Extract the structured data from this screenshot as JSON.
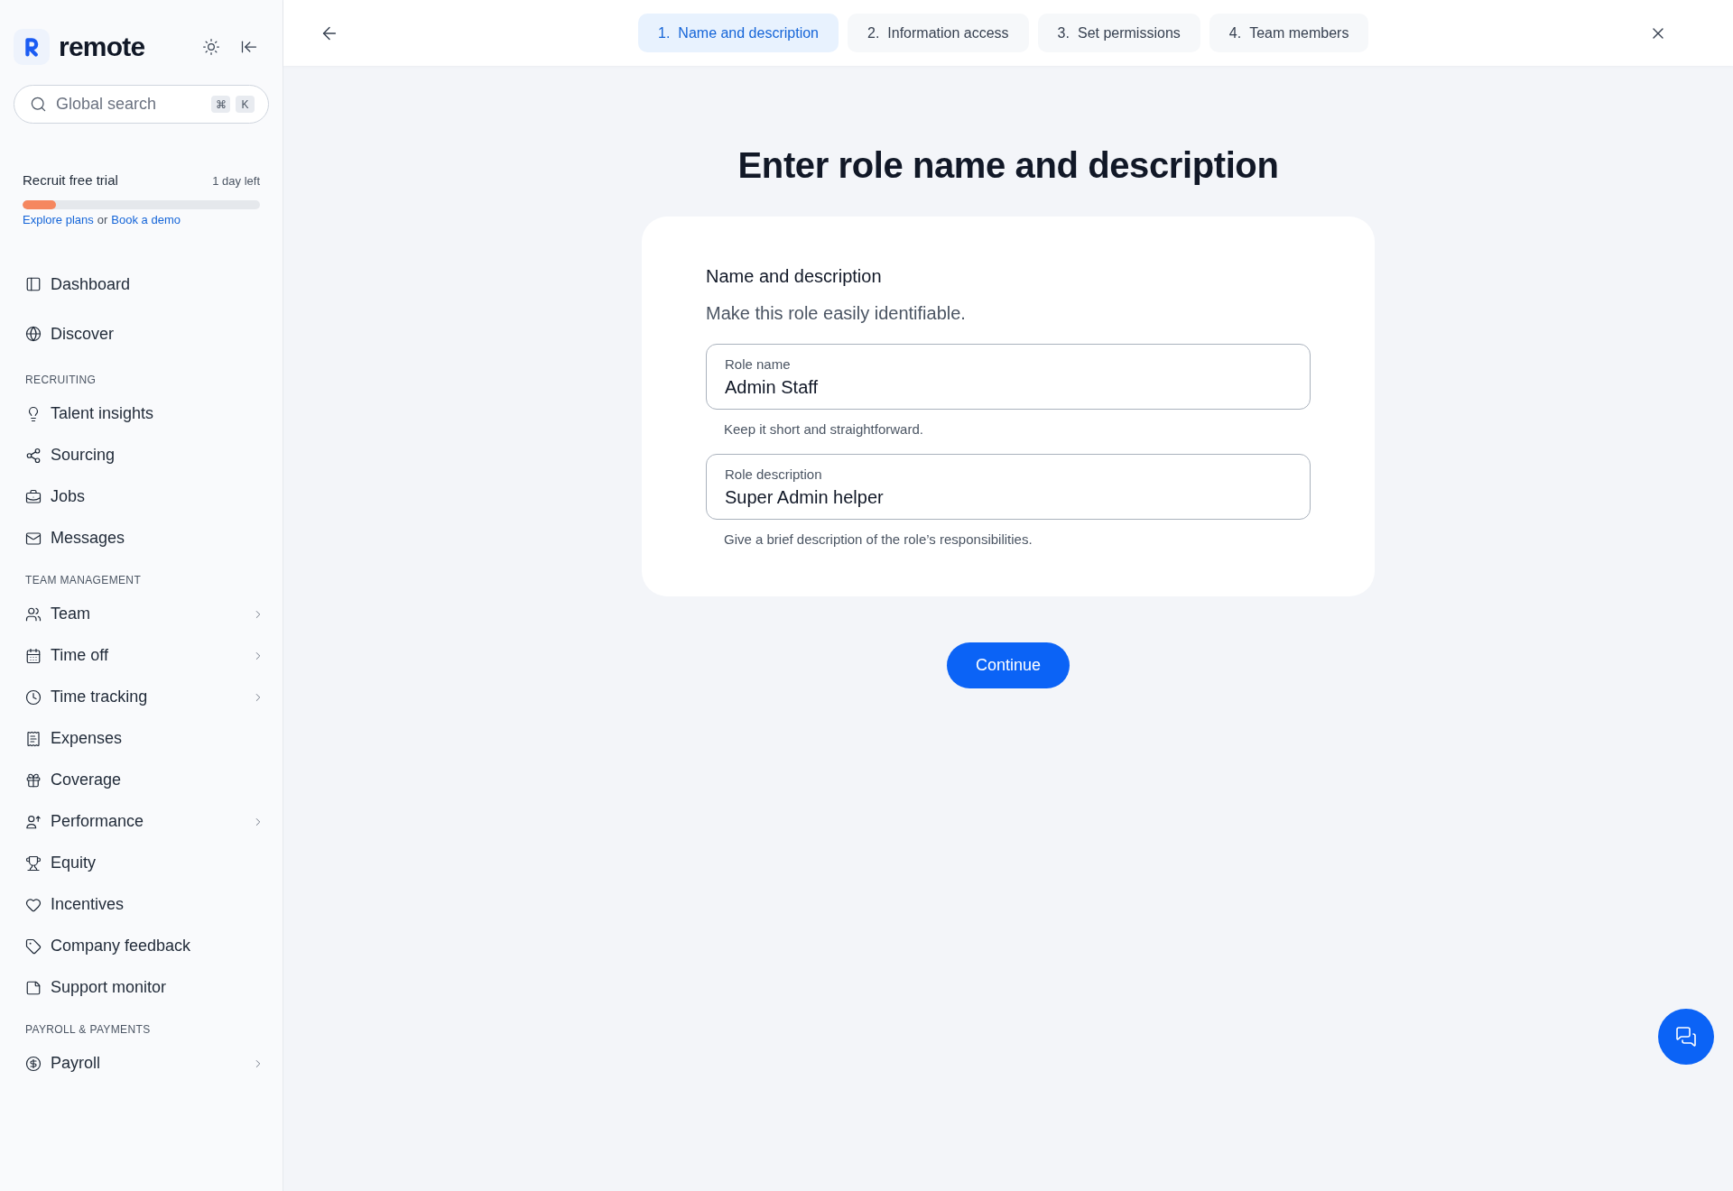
{
  "sidebar": {
    "logo_text": "remote",
    "search": {
      "placeholder": "Global search",
      "shortcut": [
        "⌘",
        "K"
      ]
    },
    "trial": {
      "title": "Recruit free trial",
      "remaining": "1 day left",
      "level": 0.14,
      "links": [
        "Explore plans",
        "Book a demo"
      ],
      "separator": "or"
    },
    "sections": [
      {
        "items": [
          {
            "label": "Dashboard",
            "has_submenu": false,
            "selected": false
          },
          {
            "label": "Discover",
            "has_submenu": false,
            "selected": false
          }
        ]
      },
      {
        "heading": "RECRUITING",
        "items": [
          {
            "label": "Talent insights",
            "has_submenu": false,
            "selected": false
          },
          {
            "label": "Sourcing",
            "has_submenu": false,
            "selected": false
          },
          {
            "label": "Jobs",
            "has_submenu": false,
            "selected": false
          },
          {
            "label": "Messages",
            "has_submenu": false,
            "selected": false
          }
        ]
      },
      {
        "heading": "TEAM MANAGEMENT",
        "items": [
          {
            "label": "Team",
            "has_submenu": true,
            "selected": false
          },
          {
            "label": "Time off",
            "has_submenu": true,
            "selected": false
          },
          {
            "label": "Time tracking",
            "has_submenu": true,
            "selected": false
          },
          {
            "label": "Expenses",
            "has_submenu": false,
            "selected": false
          },
          {
            "label": "Coverage",
            "has_submenu": false,
            "selected": false
          },
          {
            "label": "Performance",
            "has_submenu": true,
            "selected": false
          },
          {
            "label": "Equity",
            "has_submenu": false,
            "selected": false
          },
          {
            "label": "Incentives",
            "has_submenu": false,
            "selected": false
          },
          {
            "label": "Company feedback",
            "has_submenu": false,
            "selected": false
          },
          {
            "label": "Support monitor",
            "has_submenu": false,
            "selected": false
          }
        ]
      },
      {
        "heading": "PAYROLL & PAYMENTS",
        "items": [
          {
            "label": "Payroll",
            "has_submenu": true,
            "selected": false
          }
        ]
      }
    ]
  },
  "stepper": {
    "steps": [
      {
        "number": "1.",
        "label": "Name and description",
        "selected": true
      },
      {
        "number": "2.",
        "label": "Information access",
        "selected": false
      },
      {
        "number": "3.",
        "label": "Set permissions",
        "selected": false
      },
      {
        "number": "4.",
        "label": "Team members",
        "selected": false
      }
    ]
  },
  "page": {
    "title": "Enter role name and description",
    "card": {
      "title": "Name and description",
      "subtitle": "Make this role easily identifiable.",
      "fields": [
        {
          "label": "Role name",
          "value": "Admin Staff",
          "helper": "Keep it short and straightforward."
        },
        {
          "label": "Role description",
          "value": "Super Admin helper",
          "helper": "Give a brief description of the role’s responsibilities."
        }
      ]
    },
    "primary_button": "Continue"
  }
}
